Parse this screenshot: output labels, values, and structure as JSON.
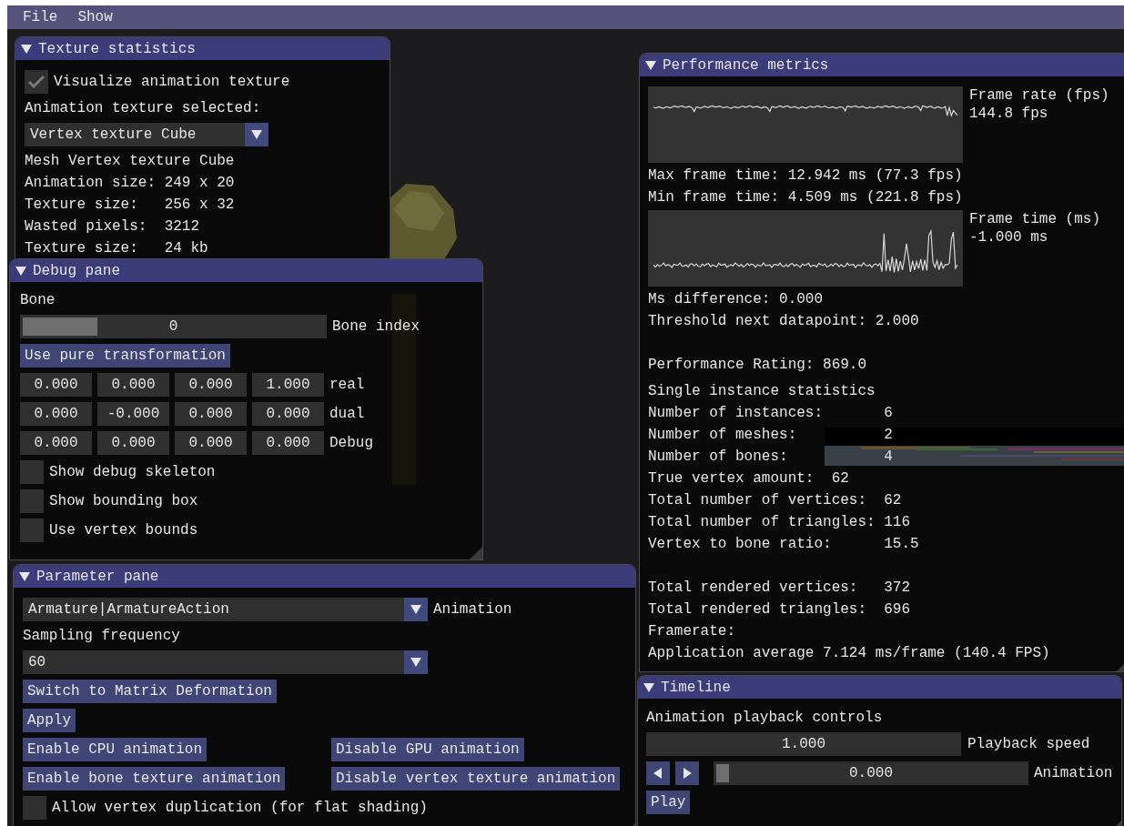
{
  "menu_bar": {
    "items": [
      {
        "label": "File"
      },
      {
        "label": "Show"
      }
    ]
  },
  "texture_statistics": {
    "title": "Texture statistics",
    "visualize_checkbox": {
      "label": "Visualize animation texture",
      "checked": true
    },
    "texture_select": {
      "label": "Animation texture selected:",
      "value": "Vertex texture Cube"
    },
    "lines": [
      "Mesh Vertex texture Cube",
      "Animation size: 249 x 20",
      "Texture size:   256 x 32",
      "Wasted pixels:  3212",
      "Texture size:   24 kb"
    ]
  },
  "debug_pane": {
    "title": "Debug pane",
    "bone_label": "Bone",
    "bone_slider": {
      "value": "0",
      "label": "Bone index",
      "level": 0
    },
    "pure_button": "Use pure transformation",
    "vectors": [
      {
        "values": [
          "0.000",
          "0.000",
          "0.000",
          "1.000"
        ],
        "label": "real"
      },
      {
        "values": [
          "0.000",
          "-0.000",
          "0.000",
          "0.000"
        ],
        "label": "dual"
      },
      {
        "values": [
          "0.000",
          "0.000",
          "0.000",
          "0.000"
        ],
        "label": "Debug"
      }
    ],
    "checkboxes": [
      {
        "label": "Show debug skeleton",
        "checked": false
      },
      {
        "label": "Show bounding box",
        "checked": false
      },
      {
        "label": "Use vertex bounds",
        "checked": false
      }
    ]
  },
  "parameter_pane": {
    "title": "Parameter pane",
    "animation_combo": {
      "value": "Armature|ArmatureAction",
      "label": "Animation"
    },
    "sampling_label": "Sampling frequency",
    "sampling_combo": {
      "value": "60"
    },
    "button_rows": [
      [
        "Switch to Matrix Deformation"
      ],
      [
        "Apply"
      ],
      [
        "Enable CPU animation",
        "Disable GPU animation"
      ],
      [
        "Enable bone texture animation",
        "Disable vertex texture animation"
      ]
    ],
    "duplication_checkbox": {
      "label": "Allow vertex duplication (for flat shading)",
      "checked": false
    }
  },
  "performance_metrics": {
    "title": "Performance metrics",
    "frame_rate_plot": {
      "label": "Frame rate (fps)",
      "reading": "144.8 fps"
    },
    "frame_time_lines": [
      "Max frame time: 12.942 ms (77.3 fps)",
      "Min frame time: 4.509 ms (221.8 fps)"
    ],
    "frame_time_plot": {
      "label": "Frame time (ms)",
      "reading": "-1.000 ms"
    },
    "groups": [
      [
        "Ms difference: 0.000",
        "Threshold next datapoint: 2.000"
      ],
      [
        "Performance Rating: 869.0"
      ],
      [
        "Single instance statistics",
        "Number of instances:       6",
        "Number of meshes:          2",
        "Number of bones:           4",
        "True vertex amount:  62",
        "Total number of vertices:  62",
        "Total number of triangles: 116",
        "Vertex to bone ratio:      15.5"
      ],
      [
        "Total rendered vertices:   372",
        "Total rendered triangles:  696",
        "Framerate:",
        "Application average 7.124 ms/frame (140.4 FPS)"
      ]
    ]
  },
  "timeline": {
    "title": "Timeline",
    "controls_label": "Animation playback controls",
    "speed_field": {
      "value": "1.000",
      "label": "Playback speed"
    },
    "animation_slider": {
      "value": "0.000",
      "label": "Animation",
      "level": 0
    },
    "play_button": "Play"
  }
}
